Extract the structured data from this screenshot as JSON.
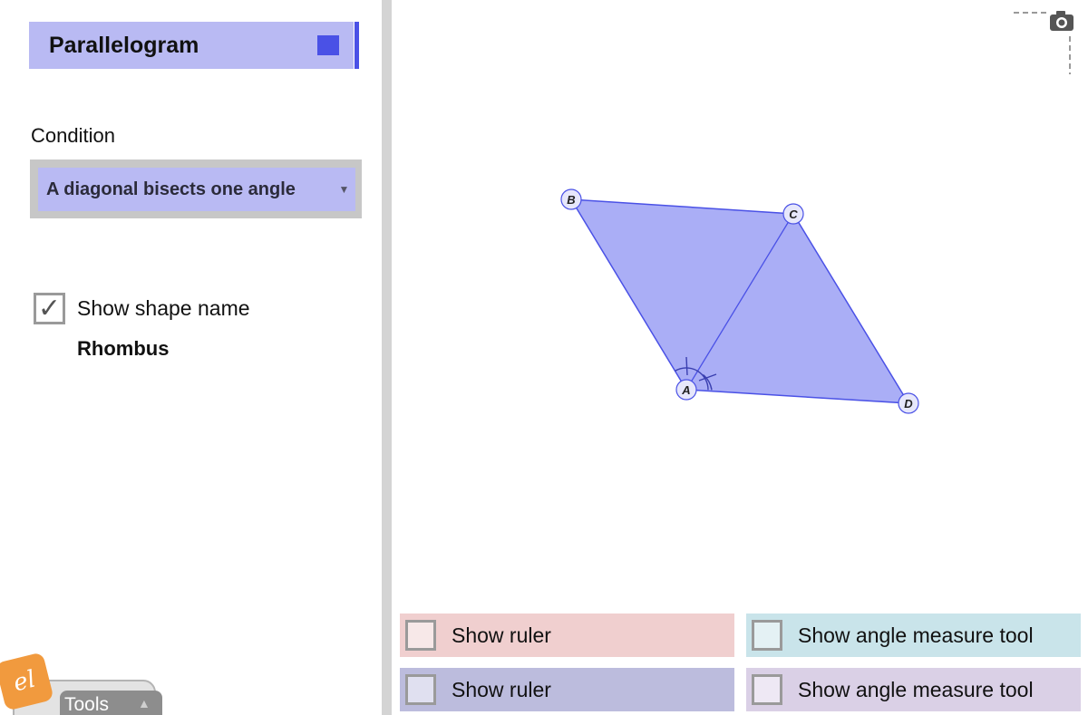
{
  "sidebar": {
    "shape_header": {
      "title": "Parallelogram",
      "swatch_color": "#4a51e6"
    },
    "condition": {
      "label": "Condition",
      "selected": "A diagonal bisects one angle",
      "arrow_icon": "triangle-down-icon"
    },
    "shape_name": {
      "checkbox_label": "Show shape name",
      "checked": true,
      "value": "Rhombus"
    },
    "tools_tab": {
      "label": "Tools",
      "arrow_icon": "triangle-up-icon"
    },
    "logo_text": "el"
  },
  "canvas": {
    "points": {
      "A": {
        "label": "A"
      },
      "B": {
        "label": "B"
      },
      "C": {
        "label": "C"
      },
      "D": {
        "label": "D"
      }
    },
    "fill_color": "#aaaef6",
    "stroke_color": "#4a51e6",
    "camera_icon": "camera-icon"
  },
  "toggles": [
    {
      "label": "Show ruler",
      "color": "#f0cfcf",
      "checked": false
    },
    {
      "label": "Show angle measure tool",
      "color": "#c9e4ea",
      "checked": false
    },
    {
      "label": "Show ruler",
      "color": "#bcbcdd",
      "checked": false
    },
    {
      "label": "Show angle measure tool",
      "color": "#dad0e6",
      "checked": false
    }
  ]
}
